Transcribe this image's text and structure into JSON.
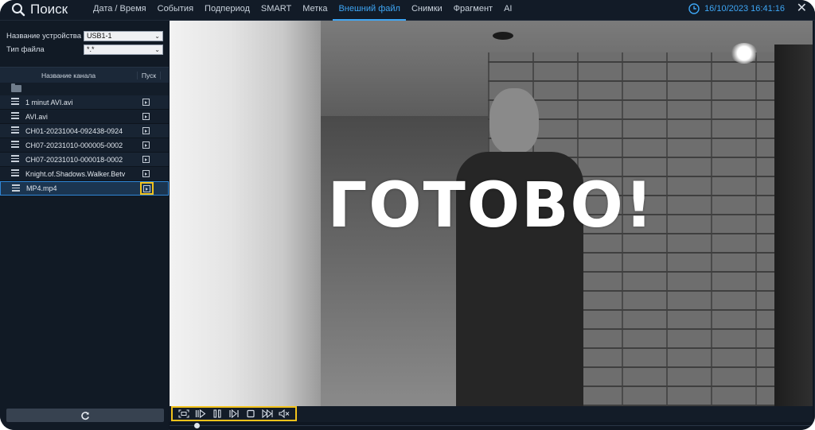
{
  "header": {
    "title": "Поиск",
    "tabs": [
      {
        "label": "Дата / Время"
      },
      {
        "label": "События"
      },
      {
        "label": "Подпериод"
      },
      {
        "label": "SMART"
      },
      {
        "label": "Метка"
      },
      {
        "label": "Внешний файл",
        "active": true
      },
      {
        "label": "Снимки"
      },
      {
        "label": "Фрагмент"
      },
      {
        "label": "AI"
      }
    ],
    "datetime": "16/10/2023 16:41:16"
  },
  "sidebar": {
    "device_label": "Название устройства",
    "device_value": "USB1-1",
    "filetype_label": "Тип файла",
    "filetype_value": "*.*",
    "col_channel": "Название канала",
    "col_play": "Пуск",
    "files": [
      {
        "name": "1 minut AVI.avi"
      },
      {
        "name": "AVI.avi"
      },
      {
        "name": "CH01-20231004-092438-0924"
      },
      {
        "name": "CH07-20231010-000005-0002"
      },
      {
        "name": "CH07-20231010-000018-0002"
      },
      {
        "name": "Knight.of.Shadows.Walker.Betv"
      },
      {
        "name": "MP4.mp4",
        "selected": true
      }
    ]
  },
  "video": {
    "overlay_text": "ГОТОВО!"
  },
  "controls": {
    "icons": [
      "fullscreen-icon",
      "slow-icon",
      "pause-icon",
      "step-frame-icon",
      "stop-icon",
      "fast-forward-icon",
      "mute-icon"
    ]
  },
  "colors": {
    "accent": "#3ea6f5",
    "highlight": "#f2c21b",
    "background": "#0f1722"
  }
}
